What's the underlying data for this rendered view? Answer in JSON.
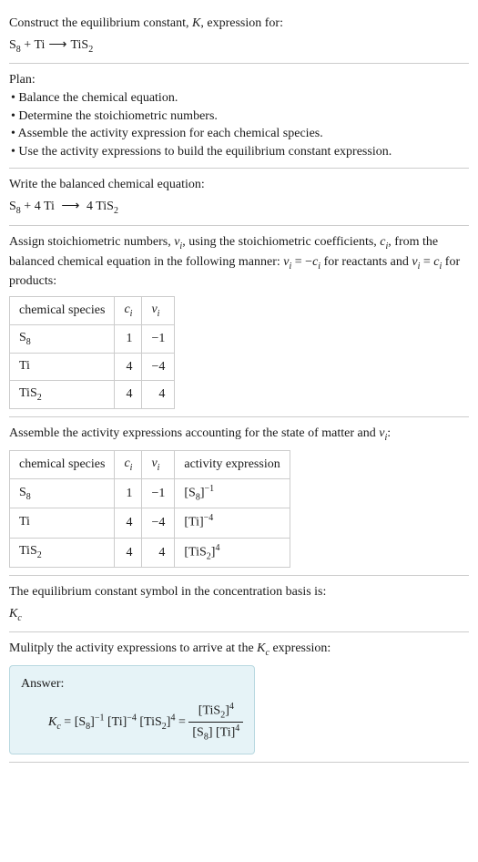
{
  "intro": {
    "line1": "Construct the equilibrium constant, ",
    "line1_k": "K",
    "line1_end": ", expression for:",
    "eq_s8": "S",
    "eq_s8_sub": "8",
    "eq_plus": " + ",
    "eq_ti": "Ti",
    "eq_arrow": "⟶",
    "eq_tis2": "TiS",
    "eq_tis2_sub": "2"
  },
  "plan": {
    "title": "Plan:",
    "items": [
      "• Balance the chemical equation.",
      "• Determine the stoichiometric numbers.",
      "• Assemble the activity expression for each chemical species.",
      "• Use the activity expressions to build the equilibrium constant expression."
    ]
  },
  "balanced": {
    "title": "Write the balanced chemical equation:",
    "s8": "S",
    "s8_sub": "8",
    "plus": " + 4 Ti ",
    "arrow": "⟶",
    "four": " 4 TiS",
    "tis2_sub": "2"
  },
  "assign": {
    "text1": "Assign stoichiometric numbers, ",
    "nu": "ν",
    "sub_i": "i",
    "text2": ", using the stoichiometric coefficients, ",
    "c": "c",
    "text3": ", from the balanced chemical equation in the following manner: ",
    "eq1_lhs": "ν",
    "eq1_eq": " = −",
    "eq1_rhs": "c",
    "text4": " for reactants and ",
    "eq2_lhs": "ν",
    "eq2_eq": " = ",
    "eq2_rhs": "c",
    "text5": " for products:",
    "headers": {
      "species": "chemical species",
      "ci": "c",
      "ci_sub": "i",
      "nui": "ν",
      "nui_sub": "i"
    },
    "rows": [
      {
        "species": "S",
        "species_sub": "8",
        "ci": "1",
        "nui": "−1"
      },
      {
        "species": "Ti",
        "species_sub": "",
        "ci": "4",
        "nui": "−4"
      },
      {
        "species": "TiS",
        "species_sub": "2",
        "ci": "4",
        "nui": "4"
      }
    ]
  },
  "activity": {
    "text1": "Assemble the activity expressions accounting for the state of matter and ",
    "nu": "ν",
    "sub_i": "i",
    "colon": ":",
    "headers": {
      "species": "chemical species",
      "ci": "c",
      "ci_sub": "i",
      "nui": "ν",
      "nui_sub": "i",
      "activity": "activity expression"
    },
    "rows": [
      {
        "species": "S",
        "species_sub": "8",
        "ci": "1",
        "nui": "−1",
        "act_base": "[S",
        "act_sub": "8",
        "act_close": "]",
        "act_sup": "−1"
      },
      {
        "species": "Ti",
        "species_sub": "",
        "ci": "4",
        "nui": "−4",
        "act_base": "[Ti",
        "act_sub": "",
        "act_close": "]",
        "act_sup": "−4"
      },
      {
        "species": "TiS",
        "species_sub": "2",
        "ci": "4",
        "nui": "4",
        "act_base": "[TiS",
        "act_sub": "2",
        "act_close": "]",
        "act_sup": "4"
      }
    ]
  },
  "symbol": {
    "text": "The equilibrium constant symbol in the concentration basis is:",
    "k": "K",
    "sub": "c"
  },
  "multiply": {
    "text1": "Mulitply the activity expressions to arrive at the ",
    "k": "K",
    "sub": "c",
    "text2": " expression:"
  },
  "answer": {
    "label": "Answer:",
    "k": "K",
    "k_sub": "c",
    "eq": " = ",
    "term1_base": "[S",
    "term1_sub": "8",
    "term1_close": "]",
    "term1_sup": "−1",
    "term2_base": " [Ti]",
    "term2_sup": "−4",
    "term3_base": " [TiS",
    "term3_sub": "2",
    "term3_close": "]",
    "term3_sup": "4",
    "eq2": " = ",
    "frac_num_base": "[TiS",
    "frac_num_sub": "2",
    "frac_num_close": "]",
    "frac_num_sup": "4",
    "frac_den1": "[S",
    "frac_den1_sub": "8",
    "frac_den1_close": "] [Ti]",
    "frac_den_sup": "4"
  }
}
